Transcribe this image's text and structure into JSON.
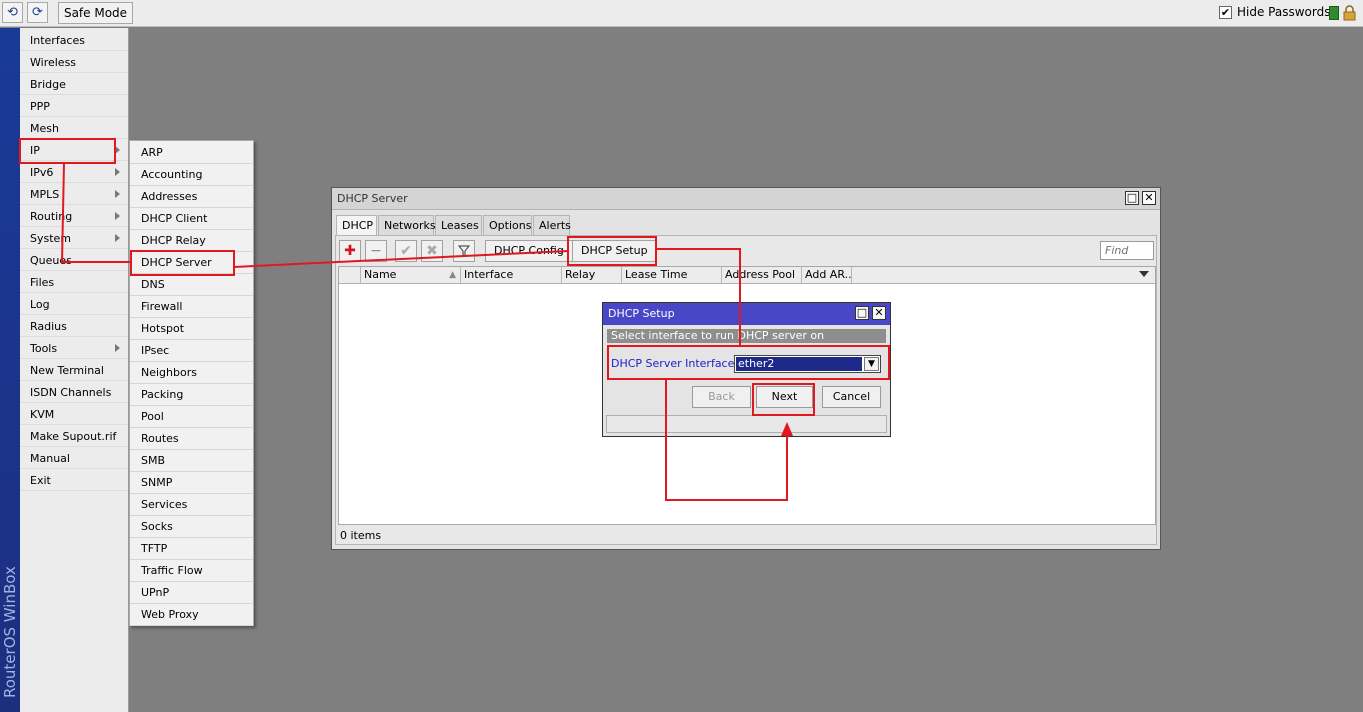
{
  "toolbar": {
    "undo_icon": "undo-icon",
    "redo_icon": "redo-icon",
    "safe_mode_label": "Safe Mode",
    "hide_passwords_label": "Hide Passwords",
    "hide_passwords_checked": "✔",
    "status_color": "#2e8b2e",
    "lock_color": "#d9a23a"
  },
  "brand": "RouterOS WinBox",
  "side_menu": [
    {
      "label": "Interfaces"
    },
    {
      "label": "Wireless"
    },
    {
      "label": "Bridge"
    },
    {
      "label": "PPP"
    },
    {
      "label": "Mesh"
    },
    {
      "label": "IP"
    },
    {
      "label": "IPv6"
    },
    {
      "label": "MPLS"
    },
    {
      "label": "Routing"
    },
    {
      "label": "System"
    },
    {
      "label": "Queues"
    },
    {
      "label": "Files"
    },
    {
      "label": "Log"
    },
    {
      "label": "Radius"
    },
    {
      "label": "Tools"
    },
    {
      "label": "New Terminal"
    },
    {
      "label": "ISDN Channels"
    },
    {
      "label": "KVM"
    },
    {
      "label": "Make Supout.rif"
    },
    {
      "label": "Manual"
    },
    {
      "label": "Exit"
    }
  ],
  "ip_submenu": [
    {
      "label": "ARP"
    },
    {
      "label": "Accounting"
    },
    {
      "label": "Addresses"
    },
    {
      "label": "DHCP Client"
    },
    {
      "label": "DHCP Relay"
    },
    {
      "label": "DHCP Server"
    },
    {
      "label": "DNS"
    },
    {
      "label": "Firewall"
    },
    {
      "label": "Hotspot"
    },
    {
      "label": "IPsec"
    },
    {
      "label": "Neighbors"
    },
    {
      "label": "Packing"
    },
    {
      "label": "Pool"
    },
    {
      "label": "Routes"
    },
    {
      "label": "SMB"
    },
    {
      "label": "SNMP"
    },
    {
      "label": "Services"
    },
    {
      "label": "Socks"
    },
    {
      "label": "TFTP"
    },
    {
      "label": "Traffic Flow"
    },
    {
      "label": "UPnP"
    },
    {
      "label": "Web Proxy"
    }
  ],
  "dhcp_window": {
    "title": "DHCP Server",
    "tabs": [
      {
        "label": "DHCP"
      },
      {
        "label": "Networks"
      },
      {
        "label": "Leases"
      },
      {
        "label": "Options"
      },
      {
        "label": "Alerts"
      }
    ],
    "buttons": {
      "dhcp_config": "DHCP Config",
      "dhcp_setup": "DHCP Setup"
    },
    "find_placeholder": "Find",
    "columns": [
      {
        "label": "Name"
      },
      {
        "label": "Interface"
      },
      {
        "label": "Relay"
      },
      {
        "label": "Lease Time"
      },
      {
        "label": "Address Pool"
      },
      {
        "label": "Add AR..."
      }
    ],
    "items_count": "0 items"
  },
  "setup_dialog": {
    "title": "DHCP Setup",
    "instruction": "Select interface to run DHCP server on",
    "interface_label": "DHCP Server Interface:",
    "interface_value": "ether2",
    "back_label": "Back",
    "next_label": "Next",
    "cancel_label": "Cancel"
  },
  "annotation_color": "#e0191f"
}
